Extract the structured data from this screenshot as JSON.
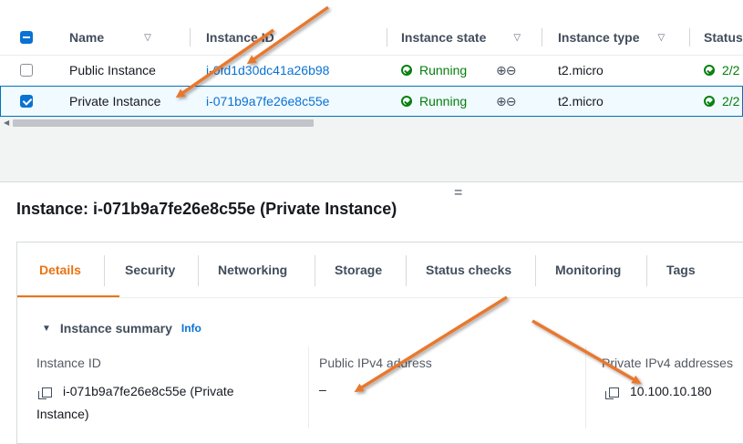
{
  "table": {
    "headers": {
      "name": "Name",
      "instance_id": "Instance ID",
      "instance_state": "Instance state",
      "instance_type": "Instance type",
      "status": "Status"
    },
    "rows": [
      {
        "name": "Public Instance",
        "instance_id": "i-0fd1d30dc41a26b98",
        "state": "Running",
        "type": "t2.micro",
        "status": "2/2",
        "selected": false
      },
      {
        "name": "Private Instance",
        "instance_id": "i-071b9a7fe26e8c55e",
        "state": "Running",
        "type": "t2.micro",
        "status": "2/2",
        "selected": true
      }
    ]
  },
  "drag_handle": "=",
  "detail": {
    "title": "Instance: i-071b9a7fe26e8c55e (Private Instance)",
    "tabs": [
      "Details",
      "Security",
      "Networking",
      "Storage",
      "Status checks",
      "Monitoring",
      "Tags"
    ],
    "active_tab": "Details",
    "summary": {
      "label": "Instance summary",
      "info": "Info"
    },
    "fields": {
      "instance_id_label": "Instance ID",
      "instance_id_line1": "i-071b9a7fe26e8c55e (Private",
      "instance_id_line2": "Instance)",
      "public_ipv4_label": "Public IPv4 address",
      "public_ipv4_value": "–",
      "private_ipv4_label": "Private IPv4 addresses",
      "private_ipv4_value": "10.100.10.180"
    }
  },
  "colors": {
    "link": "#0972d3",
    "running": "#037f0c",
    "active_tab": "#ec7211",
    "annotation_arrow": "#e8782e"
  }
}
